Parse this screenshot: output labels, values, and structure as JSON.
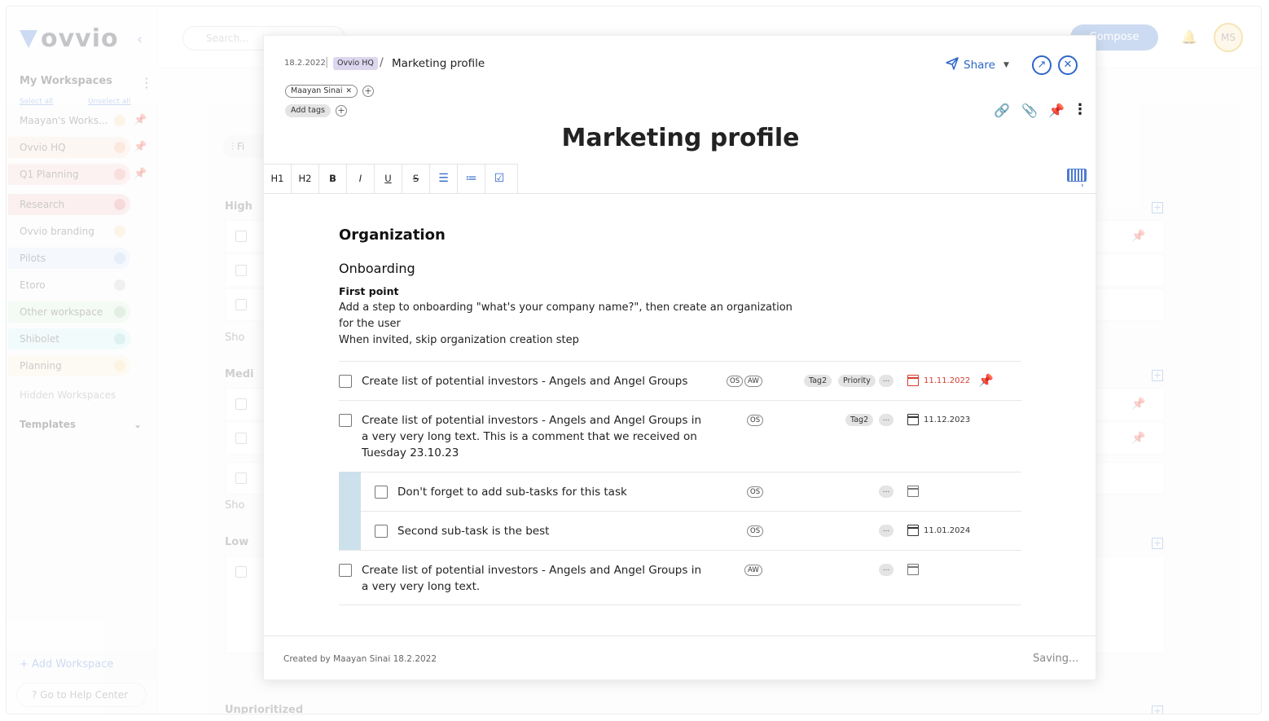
{
  "app": {
    "logo": "ovvio",
    "search_placeholder": "Search...",
    "compose_label": "Compose",
    "avatar_initials": "MS",
    "sidebar": {
      "title": "My Workspaces",
      "select_all": "Select all",
      "unselect_all": "Unselect all",
      "items": [
        {
          "label": "Maayan's Works...",
          "color": "#f7d9a8"
        },
        {
          "label": "Ovvio HQ",
          "color": "#f7b28c"
        },
        {
          "label": "Q1 Planning",
          "color": "#f08e8e"
        },
        {
          "label": "Research",
          "color": "#e07d7d"
        },
        {
          "label": "Ovvio branding",
          "color": "#f7d9a8"
        },
        {
          "label": "Pilots",
          "color": "#a8c3ef"
        },
        {
          "label": "Etoro",
          "color": "#cccccc"
        },
        {
          "label": "Other workspace",
          "color": "#9fc79f"
        },
        {
          "label": "Shibolet",
          "color": "#8fd3d3"
        },
        {
          "label": "Planning",
          "color": "#f7d59a"
        }
      ],
      "hidden_label": "Hidden Workspaces",
      "templates_label": "Templates",
      "add_workspace_label": "Add Workspace",
      "help_label": "Go to Help Center"
    },
    "board": {
      "filter_label": "Fi",
      "groups": [
        "High",
        "Medi",
        "Low",
        "Unprioritized"
      ],
      "show_label": "Sho"
    }
  },
  "modal": {
    "breadcrumb": {
      "date": "18.2.2022",
      "workspace": "Ovvio HQ",
      "title": "Marketing profile"
    },
    "share_label": "Share",
    "assignee_chip": "Maayan Sinai",
    "add_tags_label": "Add tags",
    "title": "Marketing profile",
    "toolbar": [
      "H1",
      "H2",
      "B",
      "I",
      "U",
      "S"
    ],
    "content": {
      "heading1": "Organization",
      "heading2": "Onboarding",
      "bold_line": "First point",
      "para1": "Add a step to onboarding \"what's your company name?\", then create an organization for the user",
      "para2": "When invited, skip organization creation step"
    },
    "tasks": [
      {
        "text": "Create list of potential investors - Angels and Angel Groups",
        "assignees": [
          "OS",
          "AW"
        ],
        "tags": [
          "Tag2",
          "Priority"
        ],
        "more": "...",
        "due": "11.11.2022",
        "overdue": true,
        "pinned": true
      },
      {
        "text": "Create list of potential investors - Angels and Angel Groups in a very very long text. This is a comment that we received on Tuesday 23.10.23",
        "assignees": [
          "OS"
        ],
        "tags": [
          "Tag2"
        ],
        "more": "...",
        "due": "11.12.2023"
      },
      {
        "text": "Don't forget to add sub-tasks for this task",
        "assignees": [
          "OS"
        ],
        "more": "...",
        "due": "",
        "subtask": true
      },
      {
        "text": "Second sub-task is the best",
        "assignees": [
          "OS"
        ],
        "more": "...",
        "due": "11.01.2024",
        "subtask": true
      },
      {
        "text": "Create list of potential investors - Angels and Angel Groups in a very very long text.",
        "assignees": [
          "AW"
        ],
        "more": "...",
        "due": ""
      }
    ],
    "footer": {
      "created": "Created by Maayan Sinai 18.2.2022",
      "status": "Saving..."
    }
  },
  "colors": {
    "accent": "#2d66c8",
    "overdue": "#d43d30",
    "workspace_chip": "#ddd6ef",
    "subtask_bar": "#cde1ec"
  }
}
